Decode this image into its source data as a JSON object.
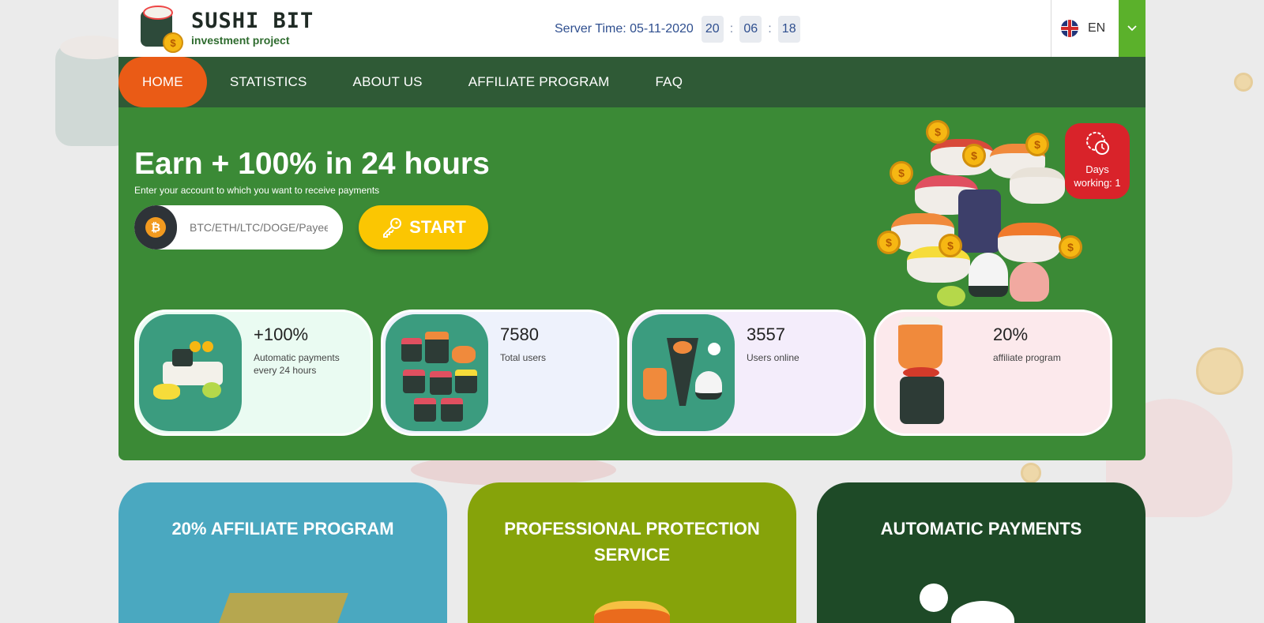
{
  "brand": {
    "title": "SUSHI BIT",
    "subtitle": "investment project"
  },
  "server_time": {
    "label": "Server Time: 05-11-2020",
    "hours": "20",
    "minutes": "06",
    "seconds": "18",
    "separator": ":"
  },
  "language": {
    "code": "EN"
  },
  "nav": {
    "items": [
      {
        "label": "HOME",
        "active": true
      },
      {
        "label": "STATISTICS"
      },
      {
        "label": "ABOUT US"
      },
      {
        "label": "AFFILIATE PROGRAM"
      },
      {
        "label": "FAQ"
      }
    ]
  },
  "hero": {
    "title": "Earn + 100% in 24 hours",
    "subtitle": "Enter your account to which you want to receive payments",
    "wallet_placeholder": "BTC/ETH/LTC/DOGE/Payeer",
    "start_label": "START",
    "days_label": "Days",
    "days_value": "working: 1"
  },
  "stats": [
    {
      "value": "+100%",
      "label": "Automatic payments every 24 hours"
    },
    {
      "value": "7580",
      "label": "Total users"
    },
    {
      "value": "3557",
      "label": "Users online"
    },
    {
      "value": "20%",
      "label": "affiliate program"
    }
  ],
  "features": [
    {
      "title": "20% AFFILIATE PROGRAM"
    },
    {
      "title": "PROFESSIONAL PROTECTION SERVICE"
    },
    {
      "title": "AUTOMATIC PAYMENTS"
    }
  ],
  "colors": {
    "nav_bg": "#2f5a36",
    "active_nav": "#ea5b16",
    "hero_bg": "#3b8a36",
    "start_button": "#fbc602",
    "days_badge": "#d9232a",
    "language_dropdown": "#5bb12b"
  },
  "icons": [
    "logo-mascot-icon",
    "uk-flag-icon",
    "chevron-down-icon",
    "bitcoin-icon",
    "key-icon",
    "clock-icon",
    "coin-icon"
  ]
}
